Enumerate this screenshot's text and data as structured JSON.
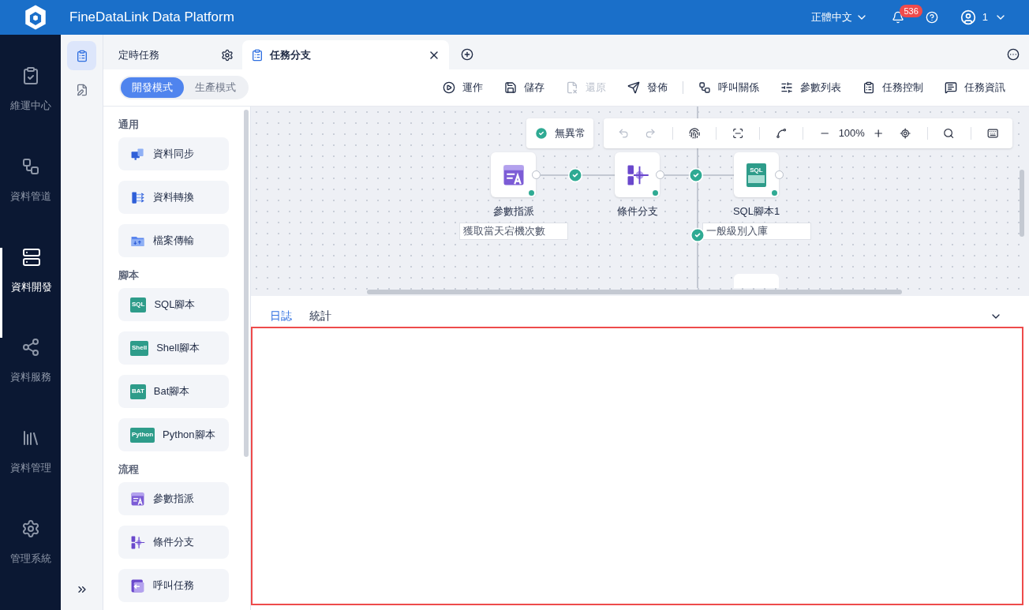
{
  "header": {
    "title": "FineDataLink Data Platform",
    "language": "正體中文",
    "notifications": "536",
    "user": "1"
  },
  "nav": [
    {
      "label": "維運中心",
      "selected": false
    },
    {
      "label": "資料管道",
      "selected": false
    },
    {
      "label": "資料開發",
      "selected": true
    },
    {
      "label": "資料服務",
      "selected": false
    },
    {
      "label": "資料管理",
      "selected": false
    },
    {
      "label": "管理系統",
      "selected": false
    }
  ],
  "side_tools": [
    {
      "selected": true
    },
    {
      "selected": false
    }
  ],
  "tabs": [
    {
      "label": "定時任務",
      "kind": "folder",
      "selected": false
    },
    {
      "label": "任務分支",
      "kind": "task",
      "selected": true
    }
  ],
  "modes": [
    {
      "label": "開發模式",
      "selected": true
    },
    {
      "label": "生產模式",
      "selected": false
    }
  ],
  "actions": [
    {
      "label": "運作",
      "disabled": false
    },
    {
      "label": "儲存",
      "disabled": false
    },
    {
      "label": "還原",
      "disabled": true
    },
    {
      "label": "發佈",
      "disabled": false
    },
    {
      "label": "呼叫關係",
      "disabled": false
    },
    {
      "label": "參數列表",
      "disabled": false
    },
    {
      "label": "任務控制",
      "disabled": false
    },
    {
      "label": "任務資訊",
      "disabled": false
    }
  ],
  "palette": [
    {
      "title": "通用",
      "items": [
        {
          "label": "資料同步",
          "kind": "sync"
        },
        {
          "label": "資料轉換",
          "kind": "transform"
        },
        {
          "label": "檔案傳輸",
          "kind": "file"
        }
      ]
    },
    {
      "title": "腳本",
      "items": [
        {
          "label": "SQL腳本",
          "kind": "script",
          "icon_text": "SQL"
        },
        {
          "label": "Shell腳本",
          "kind": "script",
          "icon_text": "Shell"
        },
        {
          "label": "Bat腳本",
          "kind": "script",
          "icon_text": "BAT"
        },
        {
          "label": "Python腳本",
          "kind": "script",
          "icon_text": "Python"
        }
      ]
    },
    {
      "title": "流程",
      "items": [
        {
          "label": "參數指派",
          "kind": "param"
        },
        {
          "label": "條件分支",
          "kind": "branch"
        },
        {
          "label": "呼叫任務",
          "kind": "call"
        }
      ]
    }
  ],
  "canvas": {
    "status": "無異常",
    "zoom": "100%",
    "nodes": [
      {
        "label": "參數指派",
        "kind": "param",
        "note": "獲取當天宕機次數"
      },
      {
        "label": "條件分支",
        "kind": "branch"
      },
      {
        "label": "SQL腳本1",
        "kind": "script",
        "icon_text": "SQL",
        "note": "一般級別入庫"
      }
    ]
  },
  "bottom_tabs": [
    {
      "label": "日誌",
      "selected": true
    },
    {
      "label": "統計",
      "selected": false
    }
  ]
}
